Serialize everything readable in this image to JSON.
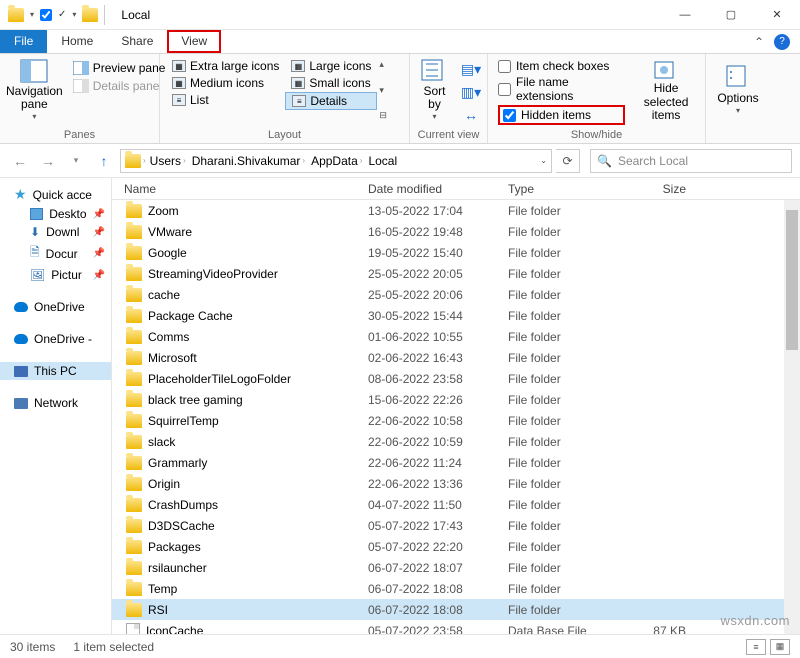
{
  "window": {
    "title": "Local",
    "minimize": "—",
    "maximize": "▢",
    "close": "✕"
  },
  "qat": {
    "check_tick": "✓"
  },
  "tabs": {
    "file": "File",
    "home": "Home",
    "share": "Share",
    "view": "View",
    "collapse": "⌃",
    "help": "?"
  },
  "ribbon": {
    "panes": {
      "nav": "Navigation\npane",
      "preview": "Preview pane",
      "details": "Details pane",
      "label": "Panes"
    },
    "layout": {
      "xl": "Extra large icons",
      "lg": "Large icons",
      "med": "Medium icons",
      "sm": "Small icons",
      "list": "List",
      "details": "Details",
      "label": "Layout"
    },
    "curview": {
      "sort": "Sort\nby",
      "label": "Current view"
    },
    "showhide": {
      "chk1": "Item check boxes",
      "chk2": "File name extensions",
      "chk3": "Hidden items",
      "hide": "Hide selected\nitems",
      "label": "Show/hide"
    },
    "options": "Options"
  },
  "addr": {
    "crumbs": [
      "Users",
      "Dharani.Shivakumar",
      "AppData",
      "Local"
    ],
    "search_placeholder": "Search Local"
  },
  "sidebar": {
    "quick": "Quick acce",
    "items": [
      "Deskto",
      "Downl",
      "Docur",
      "Pictur"
    ],
    "onedrive": "OneDrive",
    "onedrive2": "OneDrive -",
    "thispc": "This PC",
    "network": "Network"
  },
  "columns": {
    "name": "Name",
    "date": "Date modified",
    "type": "Type",
    "size": "Size"
  },
  "files": [
    {
      "name": "Zoom",
      "date": "13-05-2022 17:04",
      "type": "File folder",
      "size": ""
    },
    {
      "name": "VMware",
      "date": "16-05-2022 19:48",
      "type": "File folder",
      "size": ""
    },
    {
      "name": "Google",
      "date": "19-05-2022 15:40",
      "type": "File folder",
      "size": ""
    },
    {
      "name": "StreamingVideoProvider",
      "date": "25-05-2022 20:05",
      "type": "File folder",
      "size": ""
    },
    {
      "name": "cache",
      "date": "25-05-2022 20:06",
      "type": "File folder",
      "size": ""
    },
    {
      "name": "Package Cache",
      "date": "30-05-2022 15:44",
      "type": "File folder",
      "size": ""
    },
    {
      "name": "Comms",
      "date": "01-06-2022 10:55",
      "type": "File folder",
      "size": ""
    },
    {
      "name": "Microsoft",
      "date": "02-06-2022 16:43",
      "type": "File folder",
      "size": ""
    },
    {
      "name": "PlaceholderTileLogoFolder",
      "date": "08-06-2022 23:58",
      "type": "File folder",
      "size": ""
    },
    {
      "name": "black tree gaming",
      "date": "15-06-2022 22:26",
      "type": "File folder",
      "size": ""
    },
    {
      "name": "SquirrelTemp",
      "date": "22-06-2022 10:58",
      "type": "File folder",
      "size": ""
    },
    {
      "name": "slack",
      "date": "22-06-2022 10:59",
      "type": "File folder",
      "size": ""
    },
    {
      "name": "Grammarly",
      "date": "22-06-2022 11:24",
      "type": "File folder",
      "size": ""
    },
    {
      "name": "Origin",
      "date": "22-06-2022 13:36",
      "type": "File folder",
      "size": ""
    },
    {
      "name": "CrashDumps",
      "date": "04-07-2022 11:50",
      "type": "File folder",
      "size": ""
    },
    {
      "name": "D3DSCache",
      "date": "05-07-2022 17:43",
      "type": "File folder",
      "size": ""
    },
    {
      "name": "Packages",
      "date": "05-07-2022 22:20",
      "type": "File folder",
      "size": ""
    },
    {
      "name": "rsilauncher",
      "date": "06-07-2022 18:07",
      "type": "File folder",
      "size": ""
    },
    {
      "name": "Temp",
      "date": "06-07-2022 18:08",
      "type": "File folder",
      "size": ""
    },
    {
      "name": "RSI",
      "date": "06-07-2022 18:08",
      "type": "File folder",
      "size": "",
      "selected": true
    },
    {
      "name": "IconCache",
      "date": "05-07-2022 23:58",
      "type": "Data Base File",
      "size": "87 KB",
      "icon": "file"
    }
  ],
  "status": {
    "count": "30 items",
    "selected": "1 item selected"
  },
  "watermark": "wsxdn.com"
}
